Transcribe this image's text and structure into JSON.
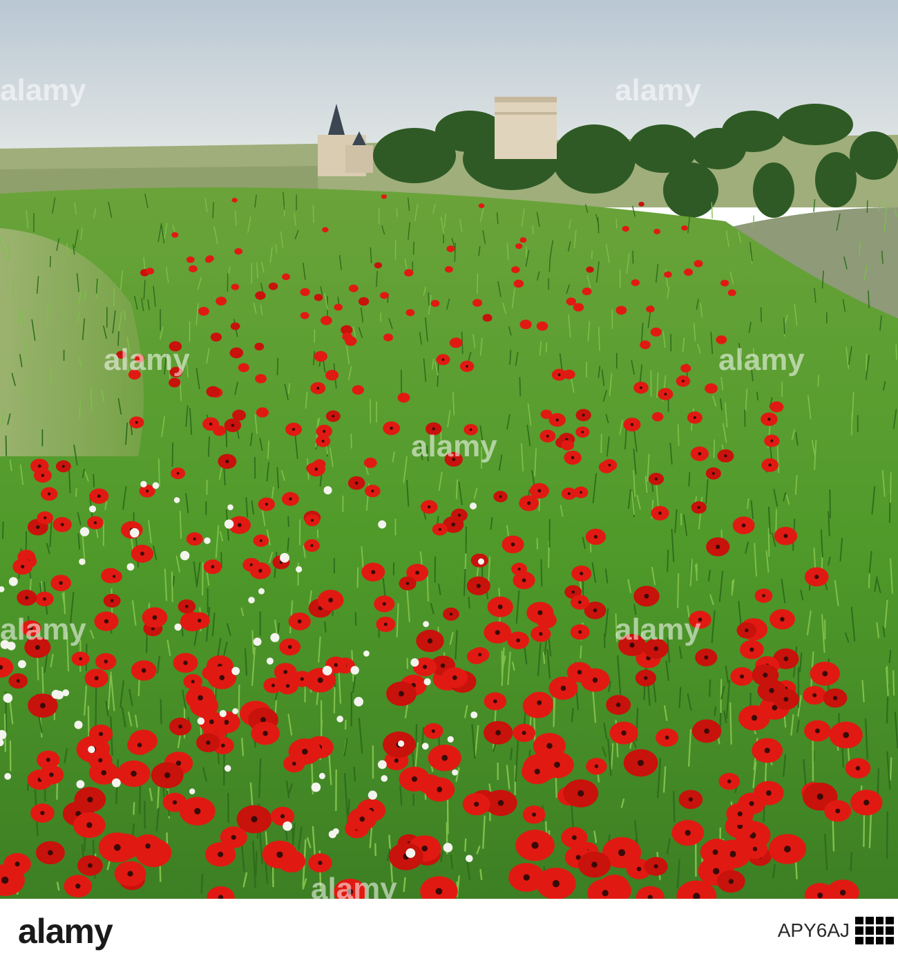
{
  "photo": {
    "subject": "poppy field",
    "watermark_text": "alamy",
    "colors": {
      "sky": "#c8d3dc",
      "field": "#4e9a2c",
      "poppy": "#e01a12",
      "castle": "#d8cbb3"
    }
  },
  "footer": {
    "brand": "alamy",
    "image_code": "APY6AJ"
  }
}
